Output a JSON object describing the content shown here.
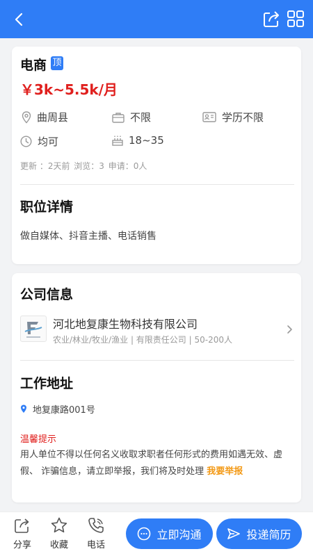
{
  "colors": {
    "primary": "#2f7df6",
    "salary": "#e0201e",
    "warning": "#f39a17"
  },
  "header": {
    "back_icon": "chevron-left-icon",
    "share_icon": "share-icon",
    "menu_icon": "grid-icon"
  },
  "job": {
    "title": "电商",
    "badge": "顶",
    "salary": "￥3k~5.5k/月",
    "location": "曲周县",
    "experience": "不限",
    "education": "学历不限",
    "gender": "均可",
    "age": "18~35",
    "meta": {
      "updated": "更新 ：2天前",
      "views": "浏览：3",
      "applies": "申请：0人"
    }
  },
  "details": {
    "section_title": "职位详情",
    "description": "做自媒体、抖音主播、电话销售"
  },
  "company": {
    "section_title": "公司信息",
    "name": "河北地复康生物科技有限公司",
    "info": "农业/林业/牧业/渔业 | 有限责任公司 | 50-200人"
  },
  "address": {
    "section_title": "工作地址",
    "text": "地复康路001号"
  },
  "notice": {
    "title": "温馨提示",
    "text": "用人单位不得以任何名义收取求职者任何形式的费用如遇无效、虚假、 诈骗信息，请立即举报，我们将及时处理",
    "report_link": "我要举报"
  },
  "bottom": {
    "share": "分享",
    "favorite": "收藏",
    "phone": "电话",
    "chat": "立即沟通",
    "apply": "投递简历"
  }
}
